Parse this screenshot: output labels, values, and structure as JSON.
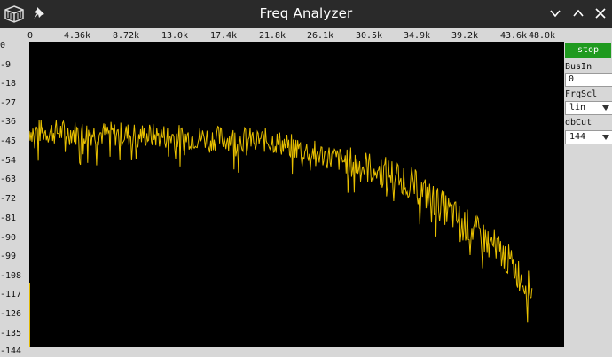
{
  "window": {
    "title": "Freq Analyzer"
  },
  "plot": {
    "x_ticks": [
      "0",
      "4.36k",
      "8.72k",
      "13.0k",
      "17.4k",
      "21.8k",
      "26.1k",
      "30.5k",
      "34.9k",
      "39.2k",
      "43.6k",
      "48.0k"
    ],
    "y_ticks": [
      "0",
      "-9",
      "-18",
      "-27",
      "-36",
      "-45",
      "-54",
      "-63",
      "-72",
      "-81",
      "-90",
      "-99",
      "-108",
      "-117",
      "-126",
      "-135",
      "-144"
    ],
    "x_range_hz": [
      0,
      48000
    ],
    "y_range_db": [
      0,
      -144
    ],
    "trace_color": "#e8c000",
    "background_color": "#000000"
  },
  "controls": {
    "stop_label": "stop",
    "stop_color": "#1f9a1f",
    "busin_label": "BusIn",
    "busin_value": "0",
    "frqscl_label": "FrqScl",
    "frqscl_value": "lin",
    "dbcut_label": "dbCut",
    "dbcut_value": "144"
  },
  "icons": [
    "app-cube-icon",
    "pin-icon",
    "chevron-down-icon",
    "chevron-up-icon",
    "close-icon",
    "dropdown-arrow-icon"
  ]
}
